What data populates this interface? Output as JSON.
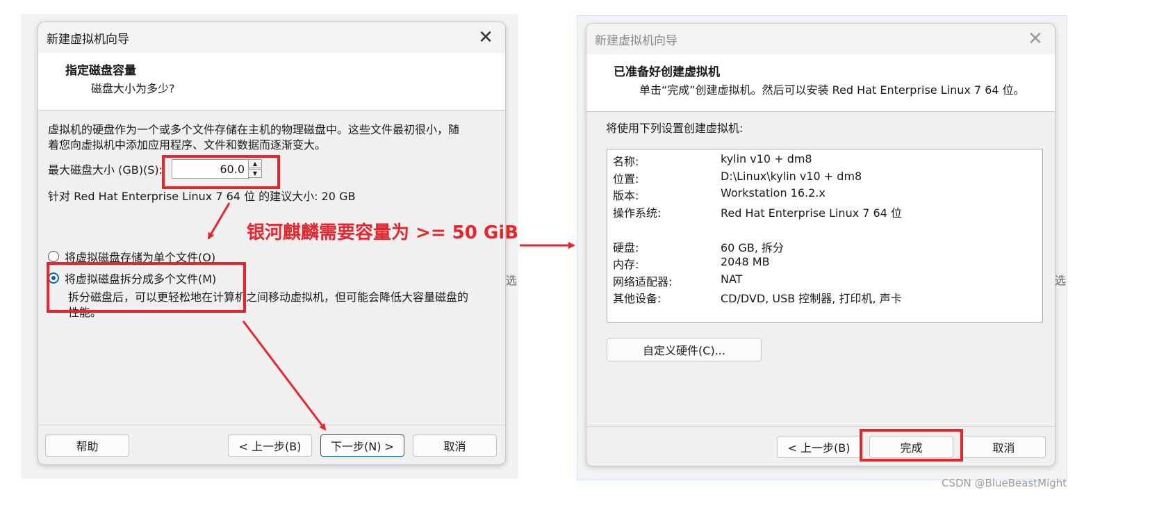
{
  "left_dialog": {
    "title": "新建虚拟机向导",
    "header_title": "指定磁盘容量",
    "header_subtitle": "磁盘大小为多少?",
    "description_line1": "虚拟机的硬盘作为一个或多个文件存储在主机的物理磁盘中。这些文件最初很小，随",
    "description_line2": "着您向虚拟机中添加应用程序、文件和数据而逐渐变大。",
    "max_size_label": "最大磁盘大小 (GB)(S):",
    "max_size_value": "60.0",
    "recommended": "针对 Red Hat Enterprise Linux 7 64 位 的建议大小: 20 GB",
    "option_single": "将虚拟磁盘存储为单个文件(O)",
    "option_split": "将虚拟磁盘拆分成多个文件(M)",
    "split_desc_line1": "拆分磁盘后，可以更轻松地在计算机之间移动虚拟机，但可能会降低大容量磁盘的",
    "split_desc_line2": "性能。",
    "buttons": {
      "help": "帮助",
      "back": "< 上一步(B)",
      "next": "下一步(N) >",
      "cancel": "取消"
    },
    "edge_char": "选"
  },
  "right_dialog": {
    "title": "新建虚拟机向导",
    "header_title": "已准备好创建虚拟机",
    "header_subtitle": "单击“完成”创建虚拟机。然后可以安装 Red Hat Enterprise Linux 7 64 位。",
    "intro": "将使用下列设置创建虚拟机:",
    "settings": [
      {
        "key": "名称:",
        "value": "kylin v10 + dm8"
      },
      {
        "key": "位置:",
        "value": "D:\\Linux\\kylin v10 + dm8"
      },
      {
        "key": "版本:",
        "value": "Workstation 16.2.x"
      },
      {
        "key": "操作系统:",
        "value": "Red Hat Enterprise Linux 7 64 位"
      },
      {
        "key": "硬盘:",
        "value": "60 GB, 拆分"
      },
      {
        "key": "内存:",
        "value": "2048 MB"
      },
      {
        "key": "网络适配器:",
        "value": "NAT"
      },
      {
        "key": "其他设备:",
        "value": "CD/DVD, USB 控制器, 打印机, 声卡"
      }
    ],
    "customize_button": "自定义硬件(C)...",
    "buttons": {
      "back": "< 上一步(B)",
      "finish": "完成",
      "cancel": "取消"
    },
    "edge_char": "选"
  },
  "annotation": {
    "text": "银河麒麟需要容量为 >= 50 GiB",
    "color": "#e8242c"
  },
  "watermark": "CSDN @BlueBeastMight"
}
